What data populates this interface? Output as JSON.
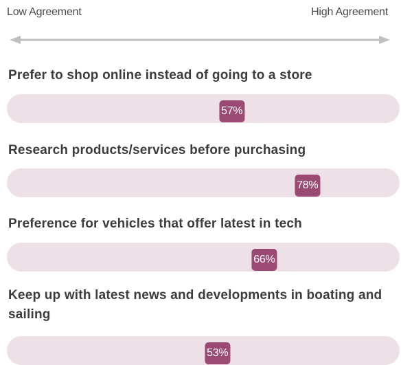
{
  "scale": {
    "low_label": "Low Agreement",
    "high_label": "High Agreement"
  },
  "colors": {
    "track": "#ede0e6",
    "marker": "#9b4a74",
    "arrow": "#bfbfbf"
  },
  "chart_data": {
    "type": "bar",
    "categories": [
      "Prefer to shop online instead of going to a store",
      "Research products/services before purchasing",
      "Preference for vehicles that offer latest in tech",
      "Keep up with latest news and developments in boating and sailing"
    ],
    "values": [
      57,
      78,
      66,
      53
    ],
    "value_labels": [
      "57%",
      "78%",
      "66%",
      "53%"
    ],
    "ylim": [
      0,
      100
    ],
    "unit": "%"
  }
}
